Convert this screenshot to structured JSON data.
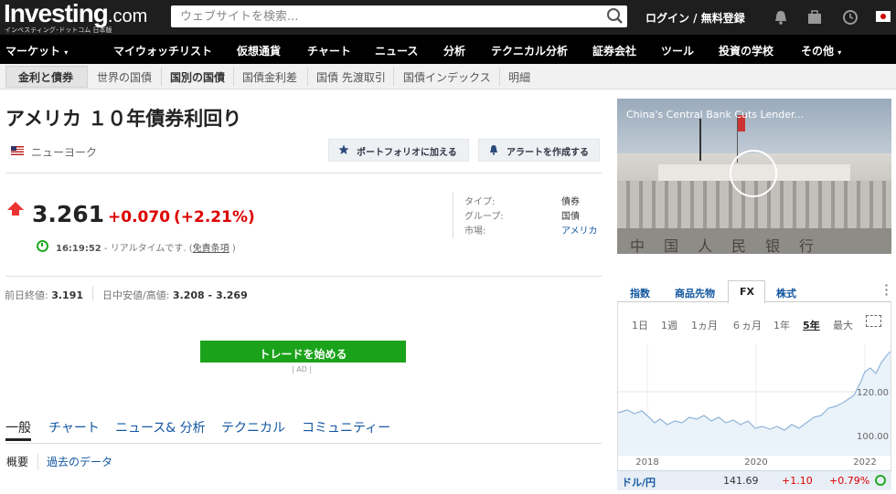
{
  "header": {
    "logo_main": "Investing",
    "logo_suffix": ".com",
    "logo_sub": "インベスティング･ドットコム 日本版",
    "search_placeholder": "ウェブサイトを検索...",
    "login": "ログイン / 無料登録"
  },
  "nav": [
    "マーケット",
    "マイウォッチリスト",
    "仮想通貨",
    "チャート",
    "ニュース",
    "分析",
    "テクニカル分析",
    "証券会社",
    "ツール",
    "投資の学校",
    "その他"
  ],
  "subnav": [
    "金利と債券",
    "世界の国債",
    "国別の国債",
    "国債金利差",
    "国債 先渡取引",
    "国債インデックス",
    "明細"
  ],
  "instrument": {
    "title": "アメリカ １０年債券利回り",
    "location": "ニューヨーク",
    "add_portfolio": "ポートフォリオに加える",
    "create_alert": "アラートを作成する",
    "price": "3.261",
    "change": "+0.070",
    "change_pct": "(+2.21%)",
    "time": "16:19:52",
    "realtime_text": " - リアルタイムです. (",
    "disclaimer": "免責条項",
    "realtime_close": " )",
    "meta": [
      {
        "k": "タイプ:",
        "v": "債券"
      },
      {
        "k": "グループ:",
        "v": "国債"
      },
      {
        "k": "市場:",
        "v": "アメリカ"
      }
    ],
    "prev_close_label": "前日終値:",
    "prev_close": "3.191",
    "day_range_label": "日中安値/高値:",
    "day_range": "3.208 - 3.269"
  },
  "trade_button": "トレードを始める",
  "ad_label": "| AD |",
  "tabs": [
    "一般",
    "チャート",
    "ニュース& 分析",
    "テクニカル",
    "コミュニティー"
  ],
  "subtabs": [
    "概要",
    "過去のデータ"
  ],
  "news": {
    "caption": "China's Central Bank Cuts Lender...",
    "image_chars": "中国人民银行"
  },
  "widget": {
    "tabs": [
      "指数",
      "商品先物",
      "FX",
      "株式"
    ],
    "active_tab": "FX",
    "periods": [
      "1日",
      "1週",
      "1ヵ月",
      "６ヵ月",
      "1年",
      "5年",
      "最大"
    ],
    "active_period": "5年",
    "y_labels": [
      "120.00",
      "100.00"
    ],
    "x_labels": [
      "2018",
      "2020",
      "2022"
    ],
    "fx": {
      "name": "ドル/円",
      "price": "141.69",
      "change": "+1.10",
      "pct": "+0.79%"
    }
  },
  "colors": {
    "up": "#d00000",
    "link": "#1256a0",
    "trade": "#1aa31a"
  }
}
